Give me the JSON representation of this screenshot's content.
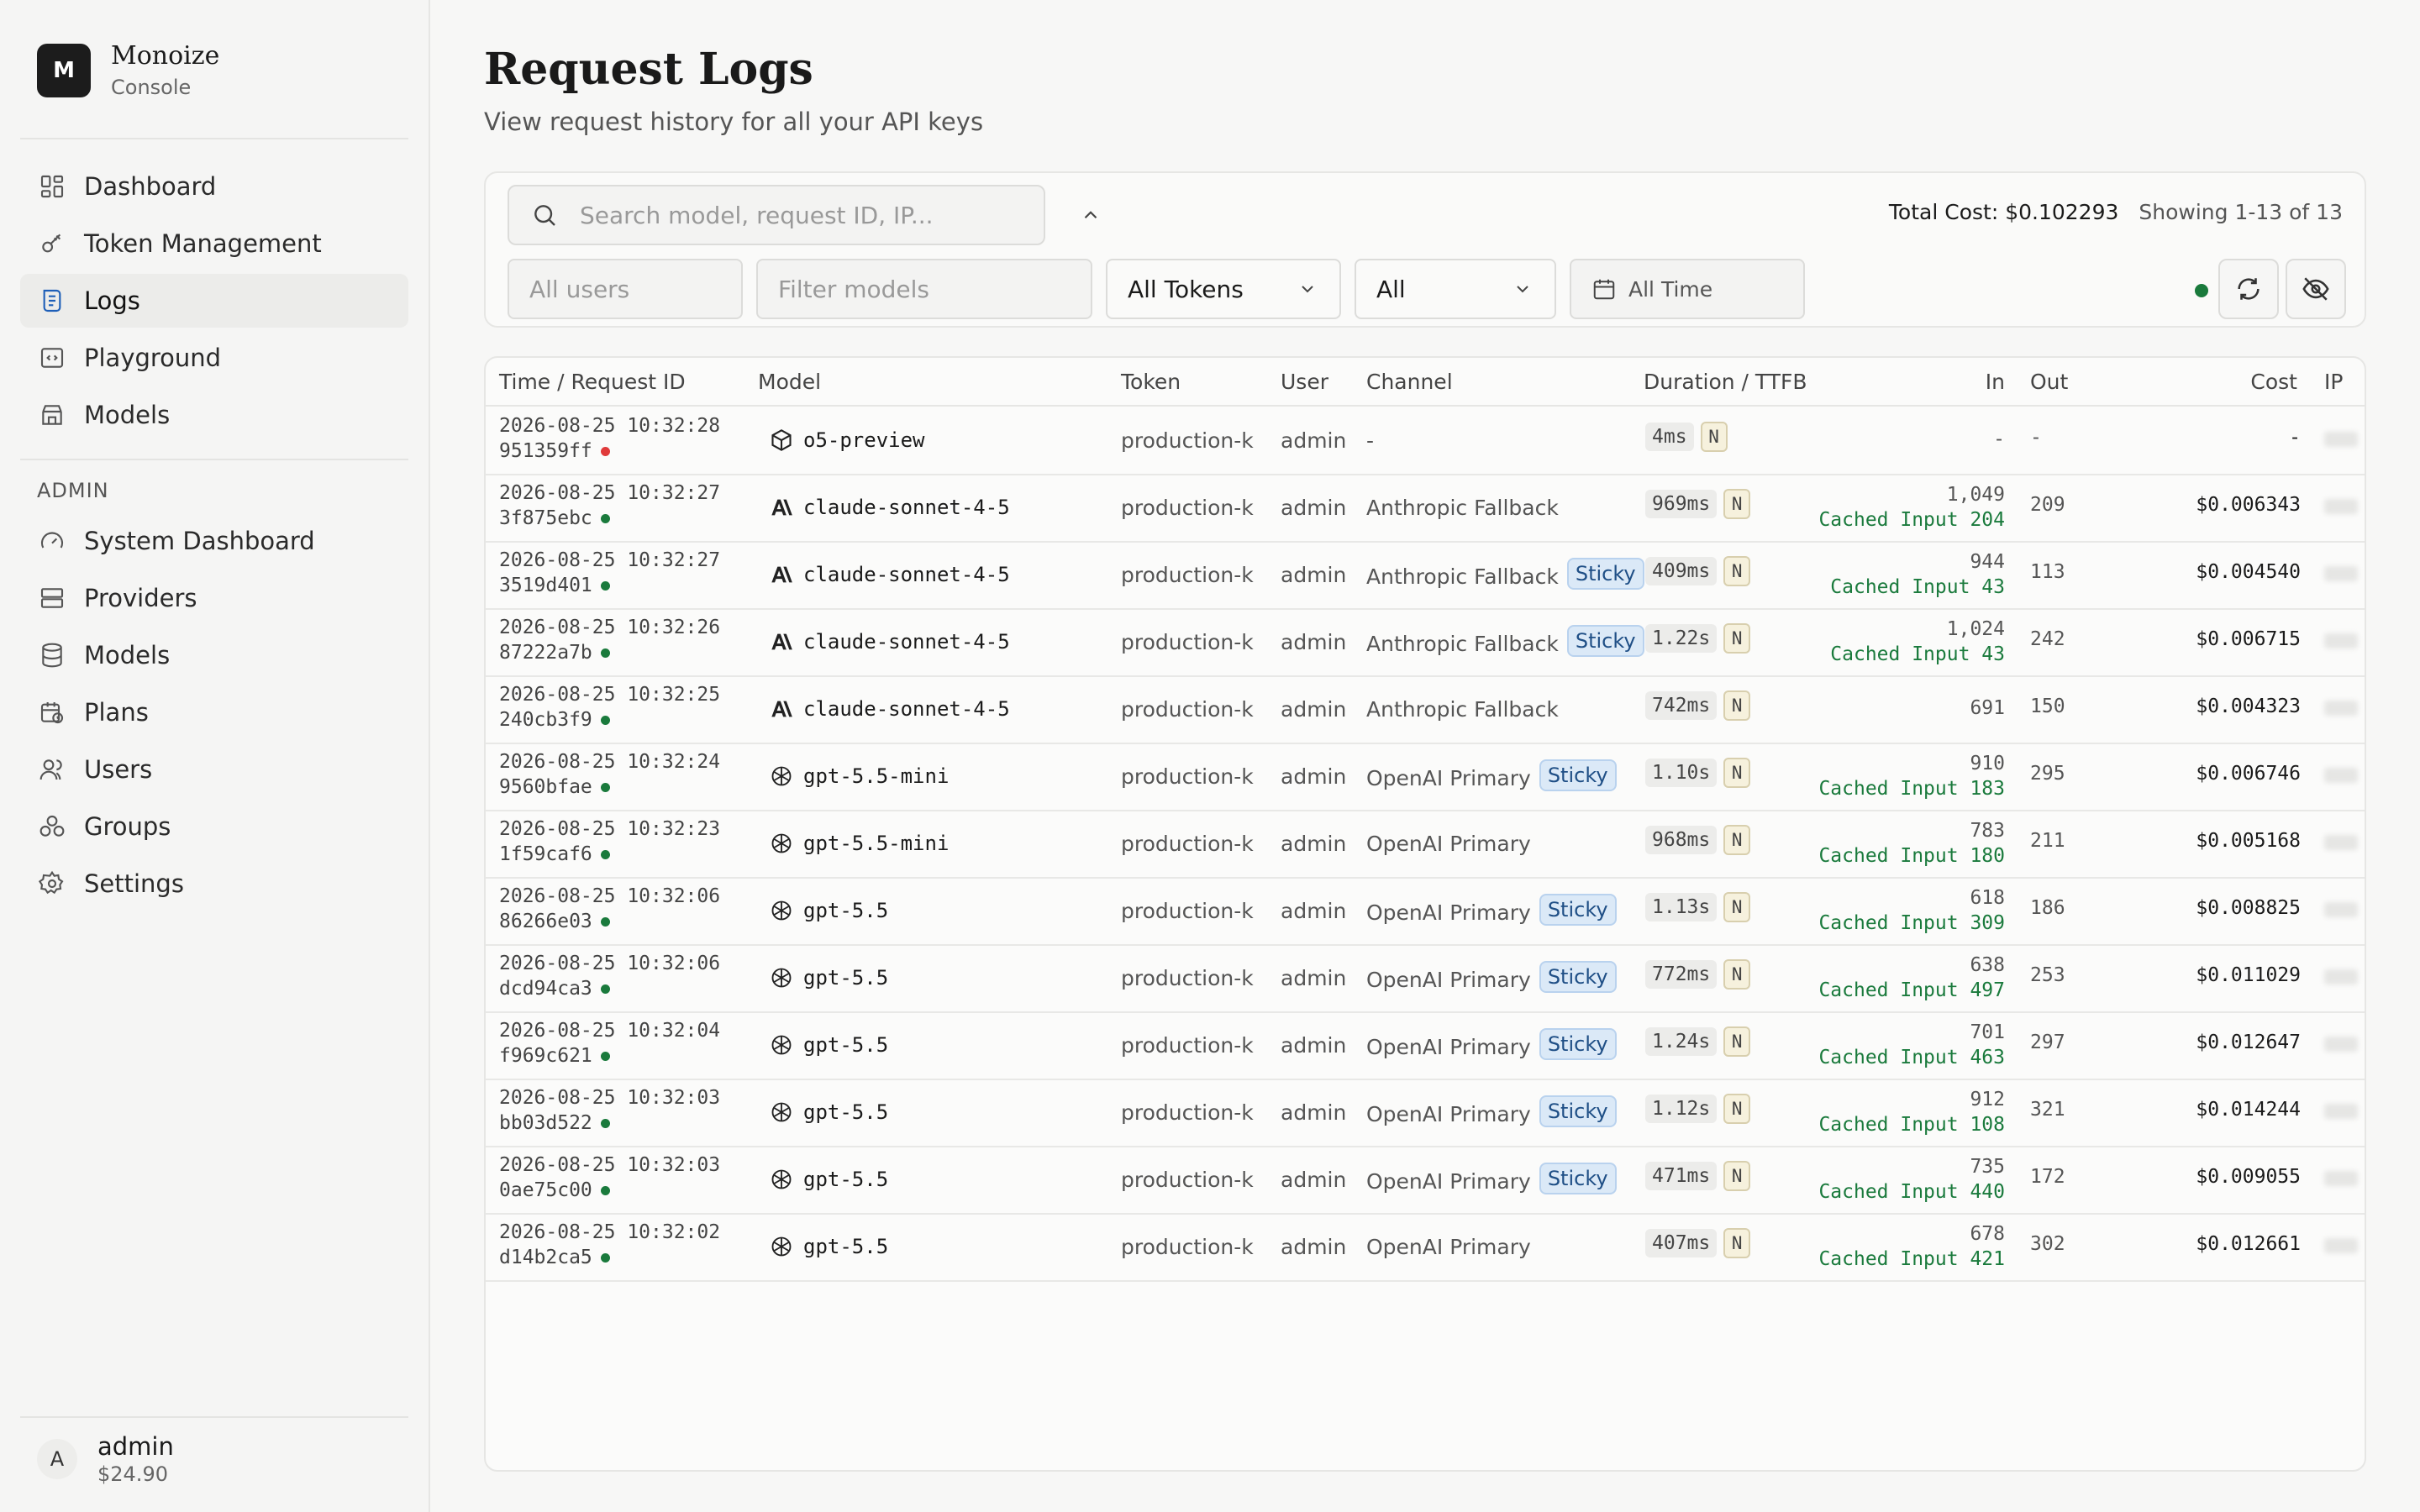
{
  "app": {
    "brand_logo": "M",
    "brand_name": "Monoize",
    "brand_sub": "Console"
  },
  "sidebar": {
    "items": [
      {
        "label": "Dashboard",
        "icon": "grid-icon"
      },
      {
        "label": "Token Management",
        "icon": "key-icon"
      },
      {
        "label": "Logs",
        "icon": "logs-icon",
        "active": true
      },
      {
        "label": "Playground",
        "icon": "code-icon"
      },
      {
        "label": "Models",
        "icon": "store-icon"
      }
    ],
    "admin_label": "ADMIN",
    "admin_items": [
      {
        "label": "System Dashboard",
        "icon": "gauge-icon"
      },
      {
        "label": "Providers",
        "icon": "server-icon"
      },
      {
        "label": "Models",
        "icon": "database-icon"
      },
      {
        "label": "Plans",
        "icon": "calendar-clock-icon"
      },
      {
        "label": "Users",
        "icon": "users-icon"
      },
      {
        "label": "Groups",
        "icon": "groups-icon"
      },
      {
        "label": "Settings",
        "icon": "gear-icon"
      }
    ],
    "user": {
      "avatar": "A",
      "name": "admin",
      "balance": "$24.90"
    }
  },
  "page": {
    "title": "Request Logs",
    "subtitle": "View request history for all your API keys"
  },
  "filters": {
    "search_placeholder": "Search model, request ID, IP...",
    "users_placeholder": "All users",
    "models_placeholder": "Filter models",
    "tokens_value": "All Tokens",
    "status_value": "All",
    "time_value": "All Time",
    "total_cost": "Total Cost: $0.102293",
    "showing": "Showing 1-13 of 13"
  },
  "colors": {
    "success": "#1a7a3c",
    "error": "#e03a3a",
    "sticky_bg": "#dbe9f7",
    "accent": "#1e5fb8"
  },
  "table": {
    "columns": {
      "time": "Time / Request ID",
      "model": "Model",
      "token": "Token",
      "user": "User",
      "channel": "Channel",
      "duration": "Duration / TTFB",
      "in": "In",
      "out": "Out",
      "cost": "Cost",
      "ip": "IP"
    },
    "rows": [
      {
        "time": "2026-08-25 10:32:28",
        "id": "951359ff",
        "status": "error",
        "model_icon": "cube-icon",
        "model": "o5-preview",
        "token": "production-key",
        "user": "admin",
        "channel": "-",
        "sticky": "",
        "duration": "4ms",
        "ttfb": "N",
        "in": "-",
        "cached": "",
        "out": "-",
        "cost": "-"
      },
      {
        "time": "2026-08-25 10:32:27",
        "id": "3f875ebc",
        "status": "ok",
        "model_icon": "anthropic-icon",
        "model": "claude-sonnet-4-5",
        "token": "production-key",
        "user": "admin",
        "channel": "Anthropic Fallback",
        "sticky": "",
        "duration": "969ms",
        "ttfb": "N",
        "in": "1,049",
        "cached": "Cached Input 204",
        "out": "209",
        "cost": "$0.006343"
      },
      {
        "time": "2026-08-25 10:32:27",
        "id": "3519d401",
        "status": "ok",
        "model_icon": "anthropic-icon",
        "model": "claude-sonnet-4-5",
        "token": "production-key",
        "user": "admin",
        "channel": "Anthropic Fallback",
        "sticky": "Sticky",
        "duration": "409ms",
        "ttfb": "N",
        "in": "944",
        "cached": "Cached Input 43",
        "out": "113",
        "cost": "$0.004540"
      },
      {
        "time": "2026-08-25 10:32:26",
        "id": "87222a7b",
        "status": "ok",
        "model_icon": "anthropic-icon",
        "model": "claude-sonnet-4-5",
        "token": "production-key",
        "user": "admin",
        "channel": "Anthropic Fallback",
        "sticky": "Sticky",
        "duration": "1.22s",
        "ttfb": "N",
        "in": "1,024",
        "cached": "Cached Input 43",
        "out": "242",
        "cost": "$0.006715"
      },
      {
        "time": "2026-08-25 10:32:25",
        "id": "240cb3f9",
        "status": "ok",
        "model_icon": "anthropic-icon",
        "model": "claude-sonnet-4-5",
        "token": "production-key",
        "user": "admin",
        "channel": "Anthropic Fallback",
        "sticky": "",
        "duration": "742ms",
        "ttfb": "N",
        "in": "691",
        "cached": "",
        "out": "150",
        "cost": "$0.004323"
      },
      {
        "time": "2026-08-25 10:32:24",
        "id": "9560bfae",
        "status": "ok",
        "model_icon": "openai-icon",
        "model": "gpt-5.5-mini",
        "token": "production-key",
        "user": "admin",
        "channel": "OpenAI Primary",
        "sticky": "Sticky",
        "duration": "1.10s",
        "ttfb": "N",
        "in": "910",
        "cached": "Cached Input 183",
        "out": "295",
        "cost": "$0.006746"
      },
      {
        "time": "2026-08-25 10:32:23",
        "id": "1f59caf6",
        "status": "ok",
        "model_icon": "openai-icon",
        "model": "gpt-5.5-mini",
        "token": "production-key",
        "user": "admin",
        "channel": "OpenAI Primary",
        "sticky": "",
        "duration": "968ms",
        "ttfb": "N",
        "in": "783",
        "cached": "Cached Input 180",
        "out": "211",
        "cost": "$0.005168"
      },
      {
        "time": "2026-08-25 10:32:06",
        "id": "86266e03",
        "status": "ok",
        "model_icon": "openai-icon",
        "model": "gpt-5.5",
        "token": "production-key",
        "user": "admin",
        "channel": "OpenAI Primary",
        "sticky": "Sticky",
        "duration": "1.13s",
        "ttfb": "N",
        "in": "618",
        "cached": "Cached Input 309",
        "out": "186",
        "cost": "$0.008825"
      },
      {
        "time": "2026-08-25 10:32:06",
        "id": "dcd94ca3",
        "status": "ok",
        "model_icon": "openai-icon",
        "model": "gpt-5.5",
        "token": "production-key",
        "user": "admin",
        "channel": "OpenAI Primary",
        "sticky": "Sticky",
        "duration": "772ms",
        "ttfb": "N",
        "in": "638",
        "cached": "Cached Input 497",
        "out": "253",
        "cost": "$0.011029"
      },
      {
        "time": "2026-08-25 10:32:04",
        "id": "f969c621",
        "status": "ok",
        "model_icon": "openai-icon",
        "model": "gpt-5.5",
        "token": "production-key",
        "user": "admin",
        "channel": "OpenAI Primary",
        "sticky": "Sticky",
        "duration": "1.24s",
        "ttfb": "N",
        "in": "701",
        "cached": "Cached Input 463",
        "out": "297",
        "cost": "$0.012647"
      },
      {
        "time": "2026-08-25 10:32:03",
        "id": "bb03d522",
        "status": "ok",
        "model_icon": "openai-icon",
        "model": "gpt-5.5",
        "token": "production-key",
        "user": "admin",
        "channel": "OpenAI Primary",
        "sticky": "Sticky",
        "duration": "1.12s",
        "ttfb": "N",
        "in": "912",
        "cached": "Cached Input 108",
        "out": "321",
        "cost": "$0.014244"
      },
      {
        "time": "2026-08-25 10:32:03",
        "id": "0ae75c00",
        "status": "ok",
        "model_icon": "openai-icon",
        "model": "gpt-5.5",
        "token": "production-key",
        "user": "admin",
        "channel": "OpenAI Primary",
        "sticky": "Sticky",
        "duration": "471ms",
        "ttfb": "N",
        "in": "735",
        "cached": "Cached Input 440",
        "out": "172",
        "cost": "$0.009055"
      },
      {
        "time": "2026-08-25 10:32:02",
        "id": "d14b2ca5",
        "status": "ok",
        "model_icon": "openai-icon",
        "model": "gpt-5.5",
        "token": "production-key",
        "user": "admin",
        "channel": "OpenAI Primary",
        "sticky": "",
        "duration": "407ms",
        "ttfb": "N",
        "in": "678",
        "cached": "Cached Input 421",
        "out": "302",
        "cost": "$0.012661"
      }
    ]
  }
}
